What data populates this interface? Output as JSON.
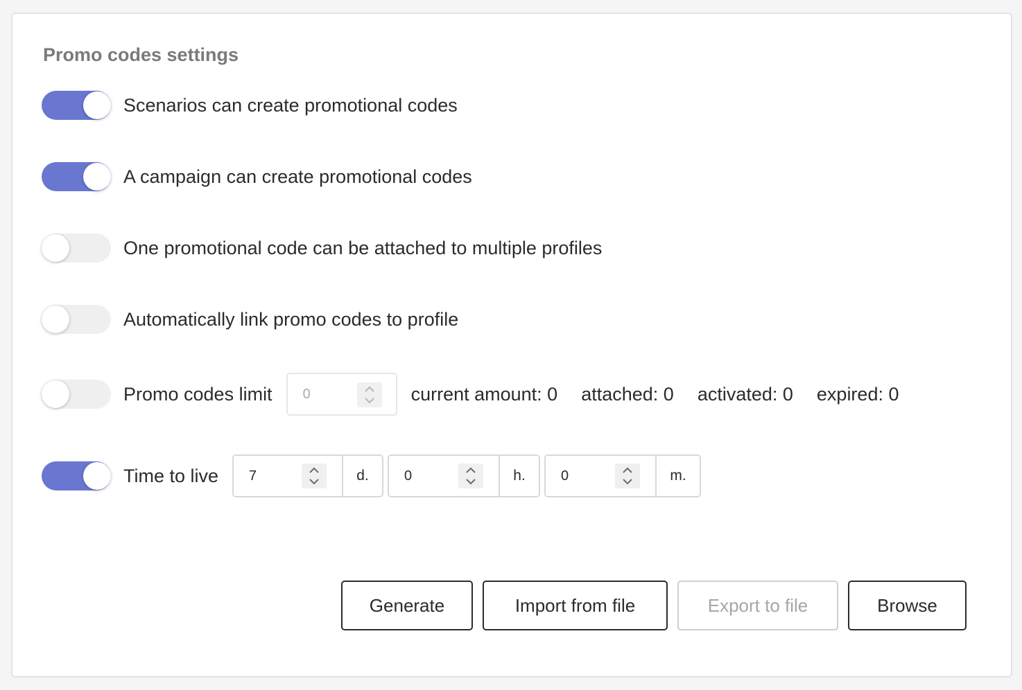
{
  "title": "Promo codes settings",
  "toggles": [
    {
      "label": "Scenarios can create promotional codes",
      "on": true
    },
    {
      "label": "A campaign can create promotional codes",
      "on": true
    },
    {
      "label": "One promotional code can be attached to multiple profiles",
      "on": false
    },
    {
      "label": "Automatically link promo codes to profile",
      "on": false
    }
  ],
  "limit": {
    "label": "Promo codes limit",
    "on": false,
    "value": "0",
    "current_amount": "current amount: 0",
    "attached": "attached: 0",
    "activated": "activated: 0",
    "expired": "expired: 0"
  },
  "ttl": {
    "label": "Time to live",
    "on": true,
    "days": {
      "value": "7",
      "unit": "d."
    },
    "hours": {
      "value": "0",
      "unit": "h."
    },
    "minutes": {
      "value": "0",
      "unit": "m."
    }
  },
  "buttons": {
    "generate": "Generate",
    "import": "Import from file",
    "export": "Export to file",
    "browse": "Browse"
  },
  "colors": {
    "accent": "#6977d0",
    "toggle_off": "#efefef"
  },
  "icons": {
    "spinner": "chevron-up-down-icon"
  }
}
